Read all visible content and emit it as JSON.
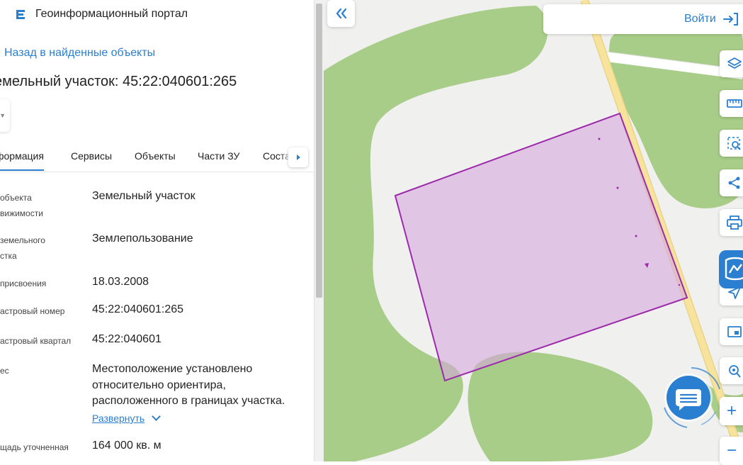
{
  "app": {
    "title": "Геоинформационный портал"
  },
  "nav": {
    "back_label": "Назад в найденные объекты"
  },
  "object": {
    "title": "емельный участок: 45:22:040601:265"
  },
  "tabs": [
    {
      "label": "формация",
      "active": true
    },
    {
      "label": "Сервисы",
      "active": false
    },
    {
      "label": "Объекты",
      "active": false
    },
    {
      "label": "Части ЗУ",
      "active": false
    },
    {
      "label": "Состав",
      "active": false
    }
  ],
  "attributes": [
    {
      "label_lines": [
        "объекта",
        "вижимости"
      ],
      "value_lines": [
        "Земельный участок"
      ]
    },
    {
      "label_lines": [
        "земельного",
        "стка"
      ],
      "value_lines": [
        "Землепользование"
      ]
    },
    {
      "label_lines": [
        "присвоения"
      ],
      "value_lines": [
        "18.03.2008"
      ]
    },
    {
      "label_lines": [
        "астровый номер"
      ],
      "value_lines": [
        "45:22:040601:265"
      ]
    },
    {
      "label_lines": [
        "астровый квартал"
      ],
      "value_lines": [
        "45:22:040601"
      ]
    },
    {
      "label_lines": [
        "ес"
      ],
      "value_lines": [
        "Местоположение установлено",
        "относительно ориентира,",
        "расположенного в границах участка."
      ]
    },
    {
      "label_lines": [
        "щадь уточненная"
      ],
      "value_lines": [
        "164 000 кв. м"
      ]
    }
  ],
  "expand": {
    "label": "Развернуть"
  },
  "map": {
    "login_label": "Войти",
    "tools": [
      "layers-icon",
      "ruler-icon",
      "select-area-icon",
      "share-icon",
      "print-icon",
      "cadastre-icon",
      "locate-icon",
      "minimap-icon",
      "search-location-icon"
    ],
    "zoom_in": "+",
    "zoom_out": "−",
    "colors": {
      "background": "#f0f0ee",
      "green": "#a8cd88",
      "road": "#f7e39c",
      "parcel_fill": "#e3c7e8",
      "parcel_stroke": "#9c2aab",
      "accent": "#2a7fd0"
    }
  }
}
